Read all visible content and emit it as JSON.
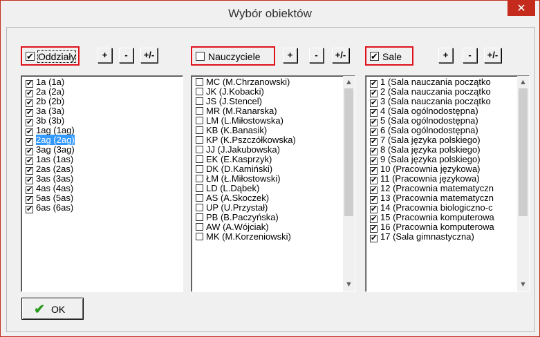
{
  "window": {
    "title": "Wybór obiektów",
    "close_glyph": "✕"
  },
  "panels": [
    {
      "label": "Oddziały",
      "checked": true,
      "buttons": [
        "+",
        "-",
        "+/-"
      ],
      "items": [
        {
          "text": "1a (1a)",
          "checked": true
        },
        {
          "text": "2a (2a)",
          "checked": true
        },
        {
          "text": "2b (2b)",
          "checked": true
        },
        {
          "text": "3a (3a)",
          "checked": true
        },
        {
          "text": "3b (3b)",
          "checked": true
        },
        {
          "text": "1ag (1ag)",
          "checked": true
        },
        {
          "text": "2ag (2ag)",
          "checked": true,
          "selected": true
        },
        {
          "text": "3ag (3ag)",
          "checked": true
        },
        {
          "text": "1as (1as)",
          "checked": true
        },
        {
          "text": "2as (2as)",
          "checked": true
        },
        {
          "text": "3as (3as)",
          "checked": true
        },
        {
          "text": "4as (4as)",
          "checked": true
        },
        {
          "text": "5as (5as)",
          "checked": true
        },
        {
          "text": "6as (6as)",
          "checked": true
        }
      ]
    },
    {
      "label": "Nauczyciele",
      "checked": false,
      "buttons": [
        "+",
        "-",
        "+/-"
      ],
      "items": [
        {
          "text": "MC (M.Chrzanowski)",
          "checked": false
        },
        {
          "text": "JK (J.Kobacki)",
          "checked": false
        },
        {
          "text": "JS (J.Stencel)",
          "checked": false
        },
        {
          "text": "MR (M.Ranarska)",
          "checked": false
        },
        {
          "text": "LM (L.Miłostowska)",
          "checked": false
        },
        {
          "text": "KB (K.Banasik)",
          "checked": false
        },
        {
          "text": "KP (K.Pszczółkowska)",
          "checked": false
        },
        {
          "text": "JJ (J.Jakubowska)",
          "checked": false
        },
        {
          "text": "EK (E.Kasprzyk)",
          "checked": false
        },
        {
          "text": "DK (D.Kamiński)",
          "checked": false
        },
        {
          "text": "ŁM (Ł.Miłostowski)",
          "checked": false
        },
        {
          "text": "LD (L.Dąbek)",
          "checked": false
        },
        {
          "text": "AS (A.Skoczek)",
          "checked": false
        },
        {
          "text": "UP (U.Przystał)",
          "checked": false
        },
        {
          "text": "PB (B.Paczyńska)",
          "checked": false
        },
        {
          "text": "AW (A.Wójciak)",
          "checked": false
        },
        {
          "text": "MK (M.Korzeniowski)",
          "checked": false
        }
      ]
    },
    {
      "label": "Sale",
      "checked": true,
      "buttons": [
        "+",
        "-",
        "+/-"
      ],
      "items": [
        {
          "text": "1 (Sala nauczania początko",
          "checked": true
        },
        {
          "text": "2 (Sala nauczania początko",
          "checked": true
        },
        {
          "text": "3 (Sala nauczania początko",
          "checked": true
        },
        {
          "text": "4 (Sala ogólnodostępna)",
          "checked": true
        },
        {
          "text": "5 (Sala ogólnodostępna)",
          "checked": true
        },
        {
          "text": "6 (Sala ogólnodostępna)",
          "checked": true
        },
        {
          "text": "7 (Sala języka polskiego)",
          "checked": true
        },
        {
          "text": "8 (Sala języka polskiego)",
          "checked": true
        },
        {
          "text": "9 (Sala języka polskiego)",
          "checked": true
        },
        {
          "text": "10 (Pracownia językowa)",
          "checked": true
        },
        {
          "text": "11 (Pracownia językowa)",
          "checked": true
        },
        {
          "text": "12 (Pracownia matematyczn",
          "checked": true
        },
        {
          "text": "13 (Pracownia matematyczn",
          "checked": true
        },
        {
          "text": "14 (Pracownia biologiczno-c",
          "checked": true
        },
        {
          "text": "15 (Pracownia komputerowa",
          "checked": true
        },
        {
          "text": "16 (Pracownia komputerowa",
          "checked": true
        },
        {
          "text": "17 (Sala gimnastyczna)",
          "checked": true
        }
      ]
    }
  ],
  "ok_button": {
    "label": "OK",
    "icon": "checkmark-icon"
  },
  "colors": {
    "highlight": "#e0101a",
    "selection": "#3399ff",
    "close": "#c42b1c",
    "ok_check": "#2a9b1c"
  }
}
